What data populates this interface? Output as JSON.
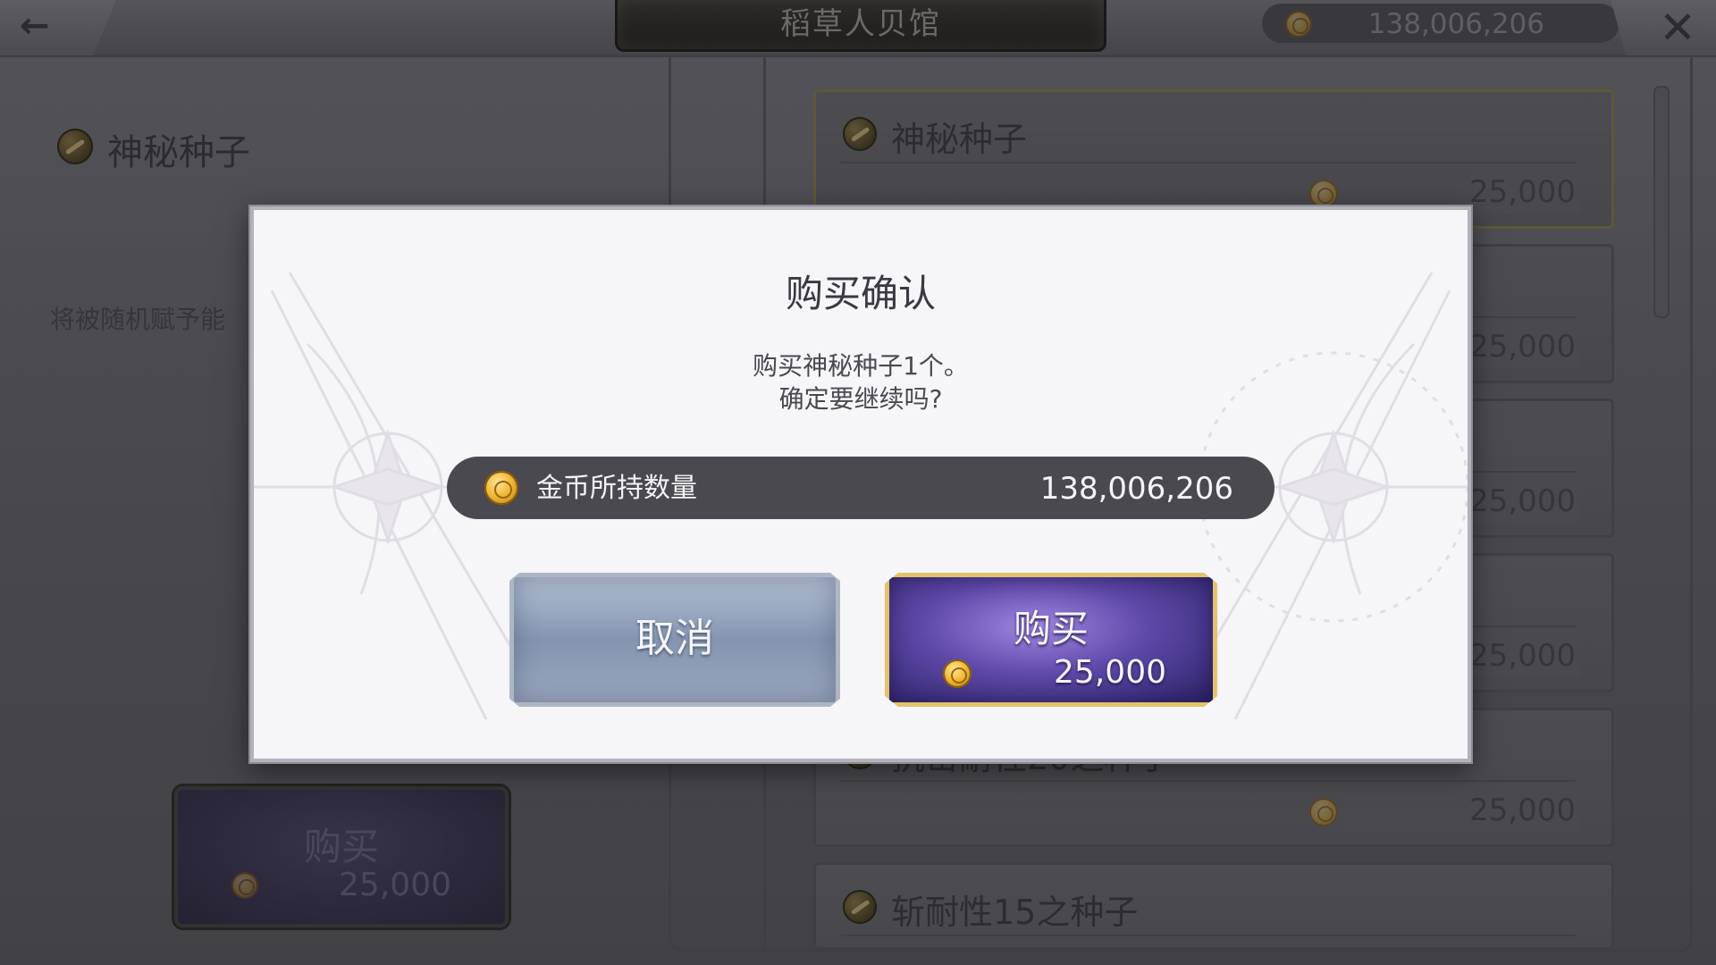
{
  "header": {
    "title": "稻草人贝馆",
    "coin_total": "138,006,206"
  },
  "left_panel": {
    "item_name": "神秘种子",
    "description": "将被随机赋予能",
    "buy_label": "购买",
    "buy_price": "25,000"
  },
  "shop_list": [
    {
      "name": "神秘种子",
      "price": "25,000",
      "selected": true
    },
    {
      "name": "",
      "price": "25,000"
    },
    {
      "name": "",
      "price": "25,000"
    },
    {
      "name": "",
      "price": "25,000"
    },
    {
      "name": "抗击耐性20之种子",
      "price": "25,000"
    },
    {
      "name": "斩耐性15之种子",
      "price": ""
    }
  ],
  "dialog": {
    "title": "购买确认",
    "message_line1": "购买神秘种子1个。",
    "message_line2": "确定要继续吗?",
    "wallet_label": "金币所持数量",
    "wallet_value": "138,006,206",
    "cancel_label": "取消",
    "buy_label": "购买",
    "buy_price": "25,000"
  },
  "colors": {
    "buy_button": "#5e48a8",
    "buy_border": "#e2c36a",
    "cancel_button": "#8595b0",
    "wallet_bar": "#4a494f"
  }
}
